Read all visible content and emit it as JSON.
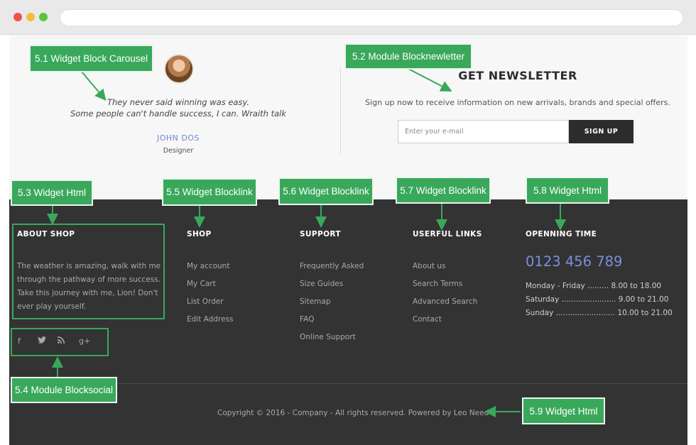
{
  "testimonial": {
    "quote_line1": "They never said winning was easy.",
    "quote_line2": "Some people can't handle success, I can. Wraith talk",
    "author": "JOHN DOS",
    "role": "Designer"
  },
  "newsletter": {
    "title": "GET NEWSLETTER",
    "description": "Sign up now to receive information on new arrivals, brands and special offers.",
    "placeholder": "Enter your e-mail",
    "button_label": "SIGN UP"
  },
  "footer": {
    "about": {
      "title": "ABOUT SHOP",
      "text": "The weather is amazing, walk with me through the pathway of more success. Take this journey with me, Lion! Don't ever play yourself."
    },
    "social_icons": [
      "facebook-icon",
      "twitter-icon",
      "rss-icon",
      "google-plus-icon"
    ],
    "shop": {
      "title": "SHOP",
      "links": [
        "My account",
        "My Cart",
        "List Order",
        "Edit Address"
      ]
    },
    "support": {
      "title": "SUPPORT",
      "links": [
        "Frequently Asked",
        "Size Guides",
        "Sitemap",
        "FAQ",
        "Online Support"
      ]
    },
    "useful": {
      "title": "USERFUL LINKS",
      "links": [
        "About us",
        "Search Terms",
        "Advanced Search",
        "Contact"
      ]
    },
    "opening": {
      "title": "OPENNING TIME",
      "phone": "0123 456 789",
      "hours": [
        "Monday - Friday ......... 8.00 to 18.00",
        "Saturday ....................... 9.00 to 21.00",
        "Sunday ......................... 10.00 to 21.00"
      ]
    },
    "copyright": "Copyright © 2016 - Company - All rights reserved. Powered by Leo Need"
  },
  "annotations": {
    "a51": "5.1 Widget Block Carousel",
    "a52": "5.2 Module Blocknewletter",
    "a53": "5.3 Widget Html",
    "a54": "5.4 Module Blocksocial",
    "a55": "5.5 Widget Blocklink",
    "a56": "5.6 Widget Blocklink",
    "a57": "5.7 Widget Blocklink",
    "a58": "5.8 Widget Html",
    "a59": "5.9 Widget Html"
  },
  "colors": {
    "accent": "#39a85b",
    "footer_bg": "#333333",
    "link_blue": "#7b8fe0"
  }
}
